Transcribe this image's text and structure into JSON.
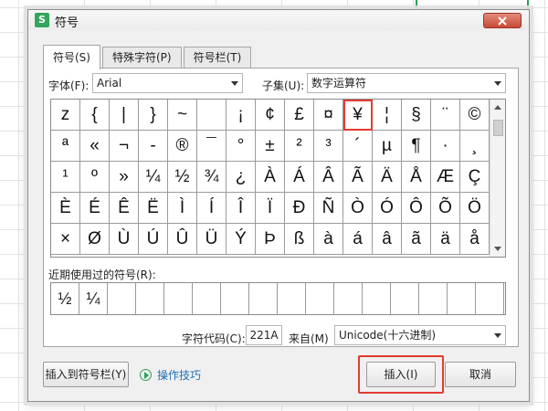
{
  "app": {
    "logo_letter": "S",
    "title": "符号"
  },
  "tabs": [
    {
      "label": "符号(S)"
    },
    {
      "label": "特殊字符(P)"
    },
    {
      "label": "符号栏(T)"
    }
  ],
  "font": {
    "label": "字体(F):",
    "value": "Arial"
  },
  "subset": {
    "label": "子集(U):",
    "value": "数字运算符"
  },
  "symbols": [
    "z",
    "{",
    "|",
    "}",
    "~",
    "",
    "¡",
    "¢",
    "£",
    "¤",
    "¥",
    "¦",
    "§",
    "¨",
    "©",
    "ª",
    "«",
    "¬",
    "-",
    "®",
    "¯",
    "°",
    "±",
    "²",
    "³",
    "´",
    "µ",
    "¶",
    "·",
    "¸",
    "¹",
    "º",
    "»",
    "¼",
    "½",
    "¾",
    "¿",
    "À",
    "Á",
    "Â",
    "Ã",
    "Ä",
    "Å",
    "Æ",
    "Ç",
    "È",
    "É",
    "Ê",
    "Ë",
    "Ì",
    "Í",
    "Î",
    "Ï",
    "Ð",
    "Ñ",
    "Ò",
    "Ó",
    "Ô",
    "Õ",
    "Ö",
    "×",
    "Ø",
    "Ù",
    "Ú",
    "Û",
    "Ü",
    "Ý",
    "Þ",
    "ß",
    "à",
    "á",
    "â",
    "ã",
    "ä",
    "å"
  ],
  "highlighted_symbol": "¥",
  "recent": {
    "label": "近期使用过的符号(R):",
    "items": [
      "½",
      "¼",
      "",
      "",
      "",
      "",
      "",
      "",
      "",
      "",
      "",
      "",
      "",
      "",
      "",
      ""
    ]
  },
  "char_code": {
    "label": "字符代码(C):",
    "value": "221A"
  },
  "from": {
    "label": "来自(M)",
    "value": "Unicode(十六进制)"
  },
  "buttons": {
    "insert_to_bar": "插入到符号栏(Y)",
    "tips": "操作技巧",
    "insert": "插入(I)",
    "cancel": "取消"
  },
  "colors": {
    "accent_green": "#2e9f5a",
    "highlight_red": "#e23b2f",
    "link_blue": "#1f6fb8"
  }
}
